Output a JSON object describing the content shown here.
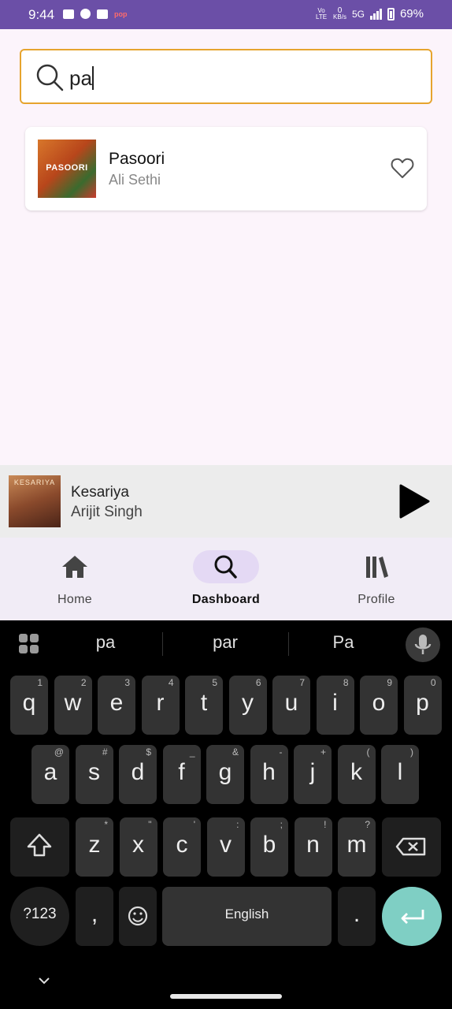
{
  "status_bar": {
    "time": "9:44",
    "net_speed_value": "0",
    "net_speed_unit": "KB/s",
    "network": "5G",
    "battery": "69%",
    "volte": "Vo LTE",
    "pop_label": "pop"
  },
  "search": {
    "query": "pa",
    "icon": "search-icon"
  },
  "results": [
    {
      "title": "Pasoori",
      "artist": "Ali Sethi",
      "art_text": "PASOORI",
      "favorite": false
    }
  ],
  "now_playing": {
    "title": "Kesariya",
    "artist": "Arijit Singh",
    "art_text": "KESARIYA"
  },
  "bottom_nav": {
    "active": "Dashboard",
    "items": [
      {
        "label": "Home",
        "icon": "home-icon"
      },
      {
        "label": "Dashboard",
        "icon": "search-icon"
      },
      {
        "label": "Profile",
        "icon": "library-icon"
      }
    ]
  },
  "keyboard": {
    "suggestions": [
      "pa",
      "par",
      "Pa"
    ],
    "row1": [
      {
        "k": "q",
        "h": "1"
      },
      {
        "k": "w",
        "h": "2"
      },
      {
        "k": "e",
        "h": "3"
      },
      {
        "k": "r",
        "h": "4"
      },
      {
        "k": "t",
        "h": "5"
      },
      {
        "k": "y",
        "h": "6"
      },
      {
        "k": "u",
        "h": "7"
      },
      {
        "k": "i",
        "h": "8"
      },
      {
        "k": "o",
        "h": "9"
      },
      {
        "k": "p",
        "h": "0"
      }
    ],
    "row2": [
      {
        "k": "a",
        "h": "@"
      },
      {
        "k": "s",
        "h": "#"
      },
      {
        "k": "d",
        "h": "$"
      },
      {
        "k": "f",
        "h": "_"
      },
      {
        "k": "g",
        "h": "&"
      },
      {
        "k": "h",
        "h": "-"
      },
      {
        "k": "j",
        "h": "+"
      },
      {
        "k": "k",
        "h": "("
      },
      {
        "k": "l",
        "h": ")"
      }
    ],
    "row3": [
      {
        "k": "z",
        "h": "*"
      },
      {
        "k": "x",
        "h": "\""
      },
      {
        "k": "c",
        "h": "'"
      },
      {
        "k": "v",
        "h": ":"
      },
      {
        "k": "b",
        "h": ";"
      },
      {
        "k": "n",
        "h": "!"
      },
      {
        "k": "m",
        "h": "?"
      }
    ],
    "symbols_label": "?123",
    "comma": ",",
    "space_label": "English",
    "period": "."
  },
  "colors": {
    "accent": "#6b4fa7",
    "search_border": "#e6a42e",
    "enter_key": "#7fcfc4",
    "nav_active_pill": "#e4d9f4"
  }
}
